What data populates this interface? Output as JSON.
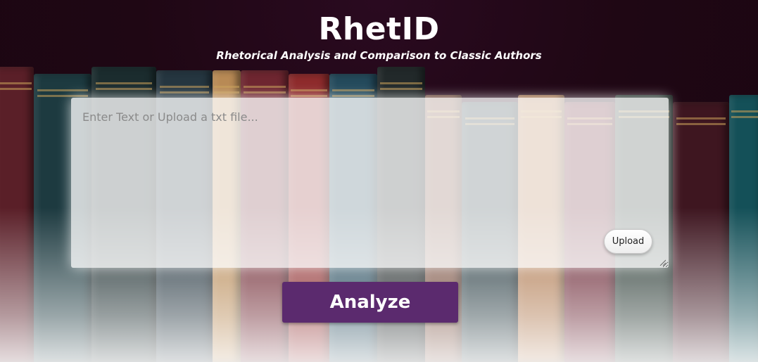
{
  "header": {
    "title": "RhetID",
    "subtitle": "Rhetorical Analysis and Comparison to Classic Authors"
  },
  "input": {
    "placeholder": "Enter Text or Upload a txt file...",
    "value": ""
  },
  "buttons": {
    "upload_label": "Upload",
    "analyze_label": "Analyze"
  },
  "colors": {
    "accent": "#5b2a6e",
    "background_dark": "#1f0714",
    "title_text": "#ffffff"
  }
}
